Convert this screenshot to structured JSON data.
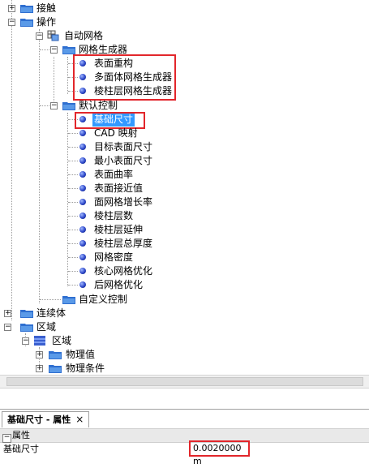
{
  "tree": {
    "contact": "接触",
    "operations": "操作",
    "auto_mesh": "自动网格",
    "mesh_generator": "网格生成器",
    "generators": [
      "表面重构",
      "多面体网格生成器",
      "棱柱层网格生成器"
    ],
    "default_controls": "默认控制",
    "controls": [
      "基础尺寸",
      "CAD 映射",
      "目标表面尺寸",
      "最小表面尺寸",
      "表面曲率",
      "表面接近值",
      "面网格增长率",
      "棱柱层数",
      "棱柱层延伸",
      "棱柱层总厚度",
      "网格密度",
      "核心网格优化",
      "后网格优化"
    ],
    "custom_controls": "自定义控制",
    "continua": "连续体",
    "regions": "区域",
    "region": "区域",
    "physics_values": "物理值",
    "physics_conditions": "物理条件"
  },
  "properties_panel": {
    "tab_title": "基础尺寸 - 属性",
    "close_symbol": "×",
    "section_label": "属性",
    "property_name": "基础尺寸",
    "property_value": "0.0020000 m"
  },
  "colors": {
    "highlight": "#e2262b",
    "selection": "#3399ff"
  }
}
